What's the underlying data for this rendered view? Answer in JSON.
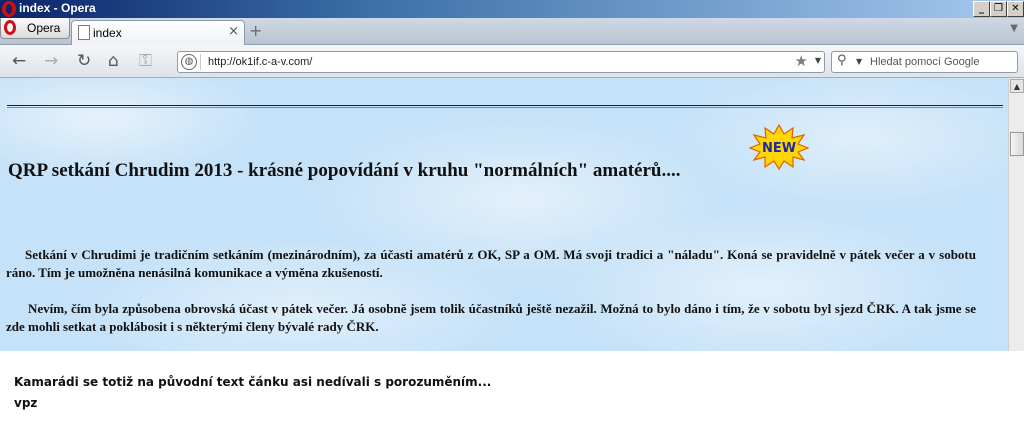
{
  "window": {
    "title": "index - Opera",
    "controls": [
      "_",
      "❐",
      "✕"
    ]
  },
  "tabs": {
    "opera_button": "Opera",
    "active_tab": "index",
    "close_glyph": "×",
    "new_tab_glyph": "+"
  },
  "toolbar": {
    "back": "←",
    "forward": "→",
    "reload": "↻",
    "home": "⌂",
    "key": "⚿",
    "address": "http://ok1if.c-a-v.com/",
    "bookmark_star": "★",
    "search_placeholder": "Hledat pomocí Google"
  },
  "page": {
    "badge": "NEW",
    "headline": "QRP setkání Chrudim 2013 - krásné popovídání v kruhu \"normálních\" amatérů....",
    "paragraphs": [
      "Setkání v Chrudimi je tradičním setkáním (mezinárodním), za účasti amatérů z OK, SP a OM. Má svoji tradici a \"náladu\". Koná se pravidelně v pátek večer a v sobotu ráno. Tím je umožněna nenásilná komunikace a výměna zkušeností.",
      "Nevím, čím byla způsobena obrovská účast v pátek večer. Já osobně jsem tolik účastníků ještě nezažil. Možná to bylo dáno i tím, že v sobotu byl sjezd ČRK. A tak jsme se zde mohli setkat a poklábosit i s některými členy bývalé rady ČRK."
    ]
  },
  "comment": {
    "line1": "Kamarádi se totiž na původní text čánku asi nedívali s porozuměním...",
    "line2": "vpz"
  },
  "colors": {
    "page_bg": "#c6e2f8",
    "badge_fill": "#ffd700",
    "badge_text": "#1b2a9e"
  }
}
